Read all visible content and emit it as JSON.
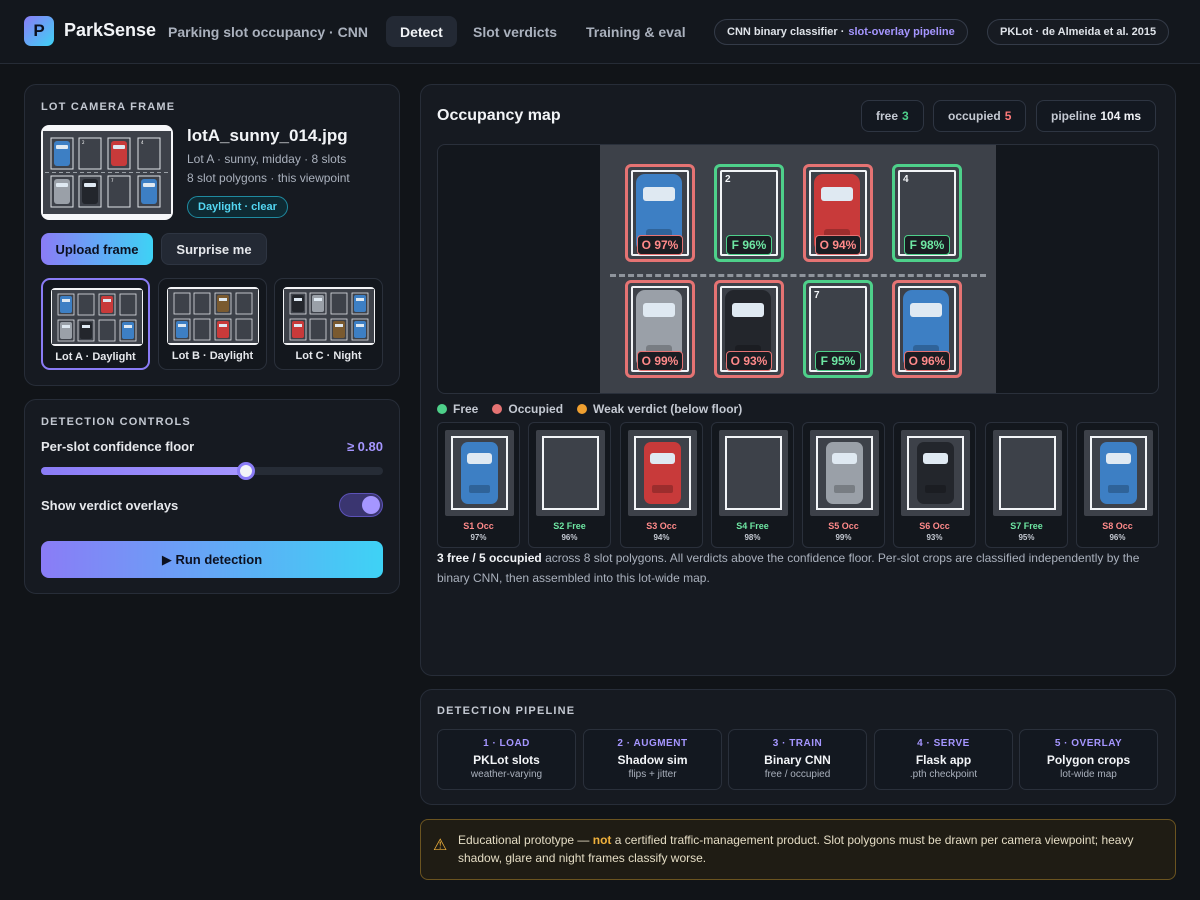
{
  "header": {
    "logo_letter": "P",
    "brand": "ParkSense",
    "subtitle": "Parking slot occupancy · CNN",
    "tabs": [
      {
        "label": "Detect",
        "active": true
      },
      {
        "label": "Slot verdicts",
        "active": false
      },
      {
        "label": "Training & eval",
        "active": false
      }
    ],
    "pill_model": {
      "text": "CNN binary classifier ·",
      "highlight": "slot-overlay pipeline"
    },
    "pill_dataset": "PKLot · de Almeida et al. 2015"
  },
  "camera": {
    "section_title": "LOT CAMERA FRAME",
    "file_name": "lotA_sunny_014.jpg",
    "meta_line1": "Lot A · sunny, midday · 8 slots",
    "meta_line2": "8 slot polygons · this viewpoint",
    "condition_badge": "Daylight · clear",
    "upload_label": "Upload frame",
    "surprise_label": "Surprise me",
    "lots": [
      {
        "label": "Lot A · Daylight",
        "selected": true
      },
      {
        "label": "Lot B · Daylight",
        "selected": false
      },
      {
        "label": "Lot C · Night",
        "selected": false
      }
    ]
  },
  "controls": {
    "section_title": "DETECTION CONTROLS",
    "floor_label": "Per-slot confidence floor",
    "floor_value": "≥ 0.80",
    "floor_fraction": 0.6,
    "overlay_label": "Show verdict overlays",
    "overlay_on": true,
    "run_label": "▶ Run detection"
  },
  "occupancy": {
    "title": "Occupancy map",
    "stat_free_label": "free",
    "stat_free_value": "3",
    "stat_occ_label": "occupied",
    "stat_occ_value": "5",
    "stat_pipe_label": "pipeline",
    "stat_pipe_value": "104 ms",
    "slot_numbers": {
      "s2": "2",
      "s4": "4",
      "s7": "7"
    },
    "verdicts": {
      "s1": "O 97%",
      "s2": "F 96%",
      "s3": "O 94%",
      "s4": "F 98%",
      "s5": "O 99%",
      "s6": "O 93%",
      "s7": "F 95%",
      "s8": "O 96%"
    },
    "legend": {
      "free": "Free",
      "occupied": "Occupied",
      "weak": "Weak verdict (below floor)"
    },
    "crops": [
      {
        "label": "S1 Occ",
        "pct": "97%"
      },
      {
        "label": "S2 Free",
        "pct": "96%"
      },
      {
        "label": "S3 Occ",
        "pct": "94%"
      },
      {
        "label": "S4 Free",
        "pct": "98%"
      },
      {
        "label": "S5 Occ",
        "pct": "99%"
      },
      {
        "label": "S6 Occ",
        "pct": "93%"
      },
      {
        "label": "S7 Free",
        "pct": "95%"
      },
      {
        "label": "S8 Occ",
        "pct": "96%"
      }
    ],
    "summary_bold": "3 free / 5 occupied",
    "summary_rest": "across 8 slot polygons. All verdicts above the confidence floor. Per-slot crops are classified independently by the binary CNN, then assembled into this lot-wide map."
  },
  "pipeline": {
    "section_title": "DETECTION PIPELINE",
    "stages": [
      {
        "step": "1 · LOAD",
        "name": "PKLot slots",
        "desc": "weather-varying"
      },
      {
        "step": "2 · AUGMENT",
        "name": "Shadow sim",
        "desc": "flips + jitter"
      },
      {
        "step": "3 · TRAIN",
        "name": "Binary CNN",
        "desc": "free / occupied"
      },
      {
        "step": "4 · SERVE",
        "name": "Flask app",
        "desc": ".pth checkpoint"
      },
      {
        "step": "5 · OVERLAY",
        "name": "Polygon crops",
        "desc": "lot-wide map"
      }
    ]
  },
  "warning": {
    "icon": "warning-icon",
    "before": "Educational prototype —",
    "bold": "not",
    "after": "a certified traffic-management product. Slot polygons must be drawn per camera viewpoint; heavy shadow, glare and night frames classify worse."
  },
  "colors": {
    "accent": "#8a7cf6",
    "accent2": "#3ed2f5",
    "free": "#4ed08a",
    "occupied": "#e57373",
    "weak": "#f0a030",
    "car_blue": "#3d7fc4",
    "car_red": "#c83a3a",
    "car_grey": "#9aa0a8",
    "car_black": "#23262c"
  }
}
